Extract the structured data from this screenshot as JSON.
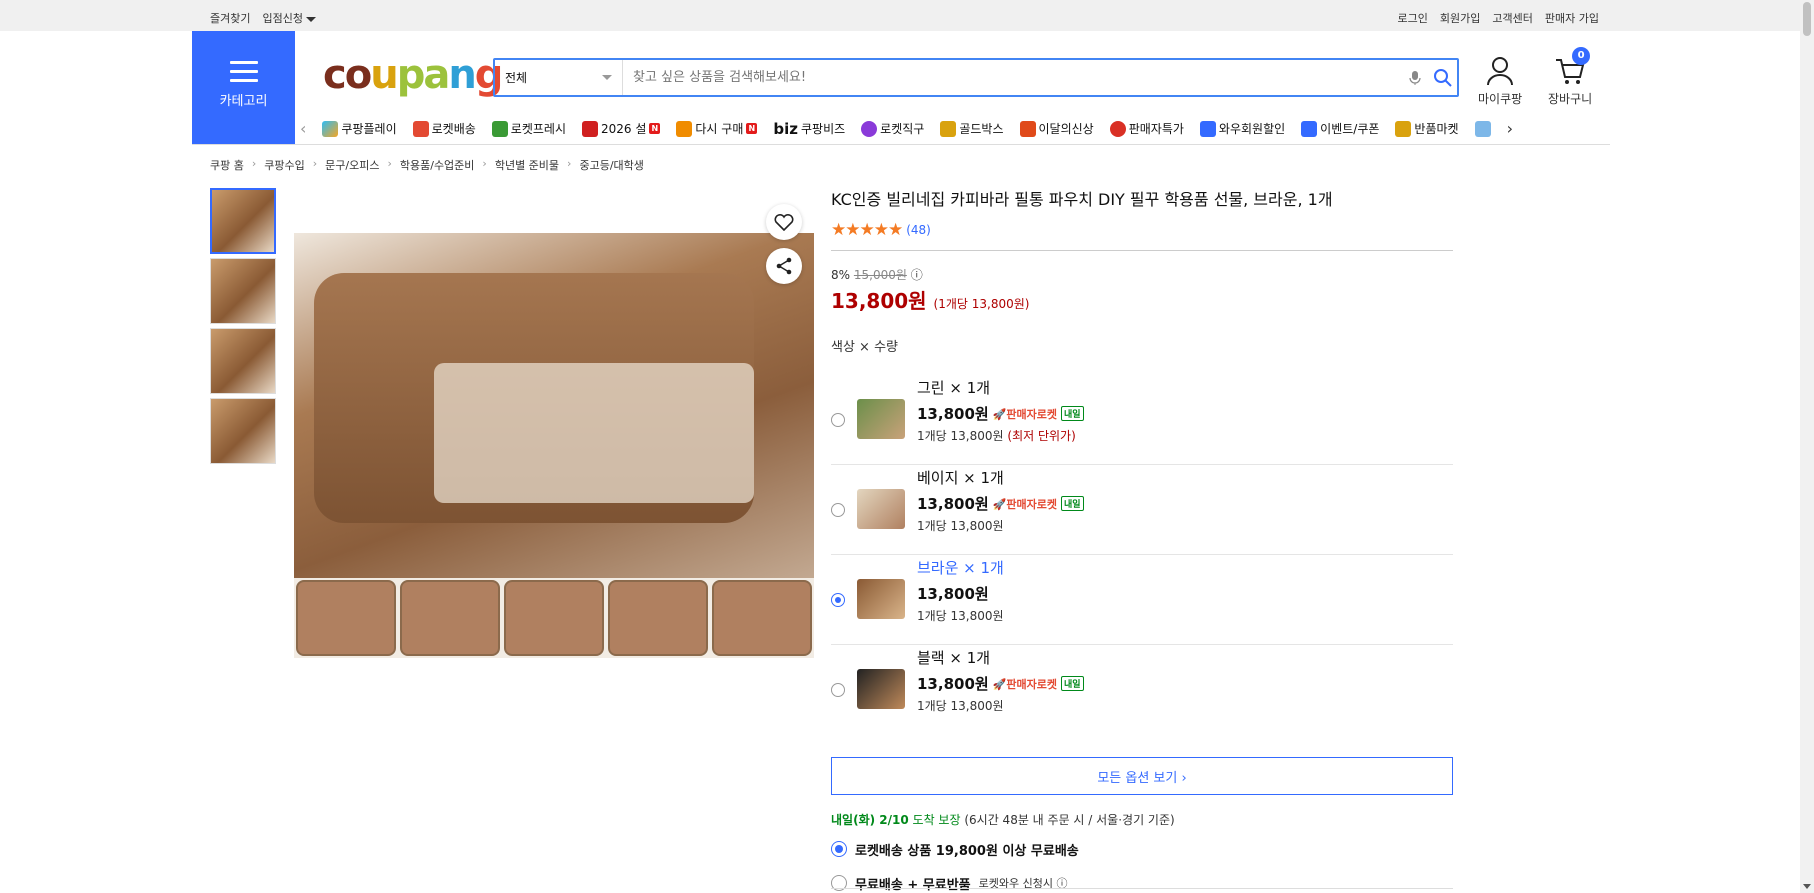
{
  "topbar": {
    "left": [
      "즐겨찾기",
      "입점신청"
    ],
    "right": [
      "로그인",
      "회원가입",
      "고객센터",
      "판매자 가입"
    ]
  },
  "category_block": {
    "label": "카테고리"
  },
  "logo": {
    "parts": [
      "co",
      "u",
      "pa",
      "n",
      "g"
    ]
  },
  "search": {
    "category": "전체",
    "placeholder": "찾고 싶은 상품을 검색해보세요!"
  },
  "header_icons": {
    "mycoupang": "마이쿠팡",
    "cart": "장바구니",
    "cart_count": "0"
  },
  "catnav": [
    {
      "label": "쿠팡플레이",
      "color": "#333",
      "badge": ""
    },
    {
      "label": "로켓배송",
      "color": "#e34a33",
      "badge": ""
    },
    {
      "label": "로켓프레시",
      "color": "#3a9a35",
      "badge": ""
    },
    {
      "label": "2026 설",
      "color": "#d02020",
      "badge": "N"
    },
    {
      "label": "다시 구매",
      "color": "#f08c00",
      "badge": "N"
    },
    {
      "label": "쿠팡비즈",
      "color": "#222",
      "badge": "",
      "prefix": "biz"
    },
    {
      "label": "로켓직구",
      "color": "#8a3ad9",
      "badge": ""
    },
    {
      "label": "골드박스",
      "color": "#d9a20e",
      "badge": ""
    },
    {
      "label": "이달의신상",
      "color": "#e04a1a",
      "badge": ""
    },
    {
      "label": "판매자특가",
      "color": "#d93025",
      "badge": ""
    },
    {
      "label": "와우회원할인",
      "color": "#346aff",
      "badge": ""
    },
    {
      "label": "이벤트/쿠폰",
      "color": "#346aff",
      "badge": ""
    },
    {
      "label": "반품마켓",
      "color": "#d9a20e",
      "badge": ""
    }
  ],
  "breadcrumb": [
    "쿠팡 홈",
    "쿠팡수입",
    "문구/오피스",
    "학용품/수업준비",
    "학년별 준비물",
    "중고등/대학생"
  ],
  "product": {
    "title": "KC인증 빌리네집 카피바라 필통 파우치 DIY 필꾸 학용품 선물, 브라운, 1개",
    "stars": "★★★★★",
    "rating_value": 4.5,
    "review_count": "(48)",
    "discount": "8%",
    "original_price": "15,000원",
    "price": "13,800원",
    "unit_price": "(1개당 13,800원)",
    "option_label": "색상 × 수량"
  },
  "options": [
    {
      "name": "그린 × 1개",
      "price": "13,800원",
      "badge": "🚀판매자로켓",
      "tomorrow": "내일",
      "per": "1개당 13,800원",
      "low": "(최저 단위가)",
      "selected": false,
      "swatch": "#6b8f4a"
    },
    {
      "name": "베이지 × 1개",
      "price": "13,800원",
      "badge": "🚀판매자로켓",
      "tomorrow": "내일",
      "per": "1개당 13,800원",
      "low": "",
      "selected": false,
      "swatch": "#d9c7a8"
    },
    {
      "name": "브라운 × 1개",
      "price": "13,800원",
      "badge": "",
      "tomorrow": "",
      "per": "1개당 13,800원",
      "low": "",
      "selected": true,
      "swatch": "#8a5a34"
    },
    {
      "name": "블랙 × 1개",
      "price": "13,800원",
      "badge": "🚀판매자로켓",
      "tomorrow": "내일",
      "per": "1개당 13,800원",
      "low": "",
      "selected": false,
      "swatch": "#222"
    }
  ],
  "all_options": "모든 옵션 보기 ›",
  "delivery": {
    "date": "내일(화) 2/10",
    "guarantee": "도착 보장",
    "note": "(6시간 48분 내 주문 시 / 서울⋅경기 기준)"
  },
  "shipping": [
    {
      "label": "로켓배송 상품 19,800원 이상 무료배송",
      "sub": "",
      "selected": true
    },
    {
      "label": "무료배송 + 무료반품",
      "sub": "로켓와우 신청시 ⓘ",
      "selected": false
    }
  ]
}
